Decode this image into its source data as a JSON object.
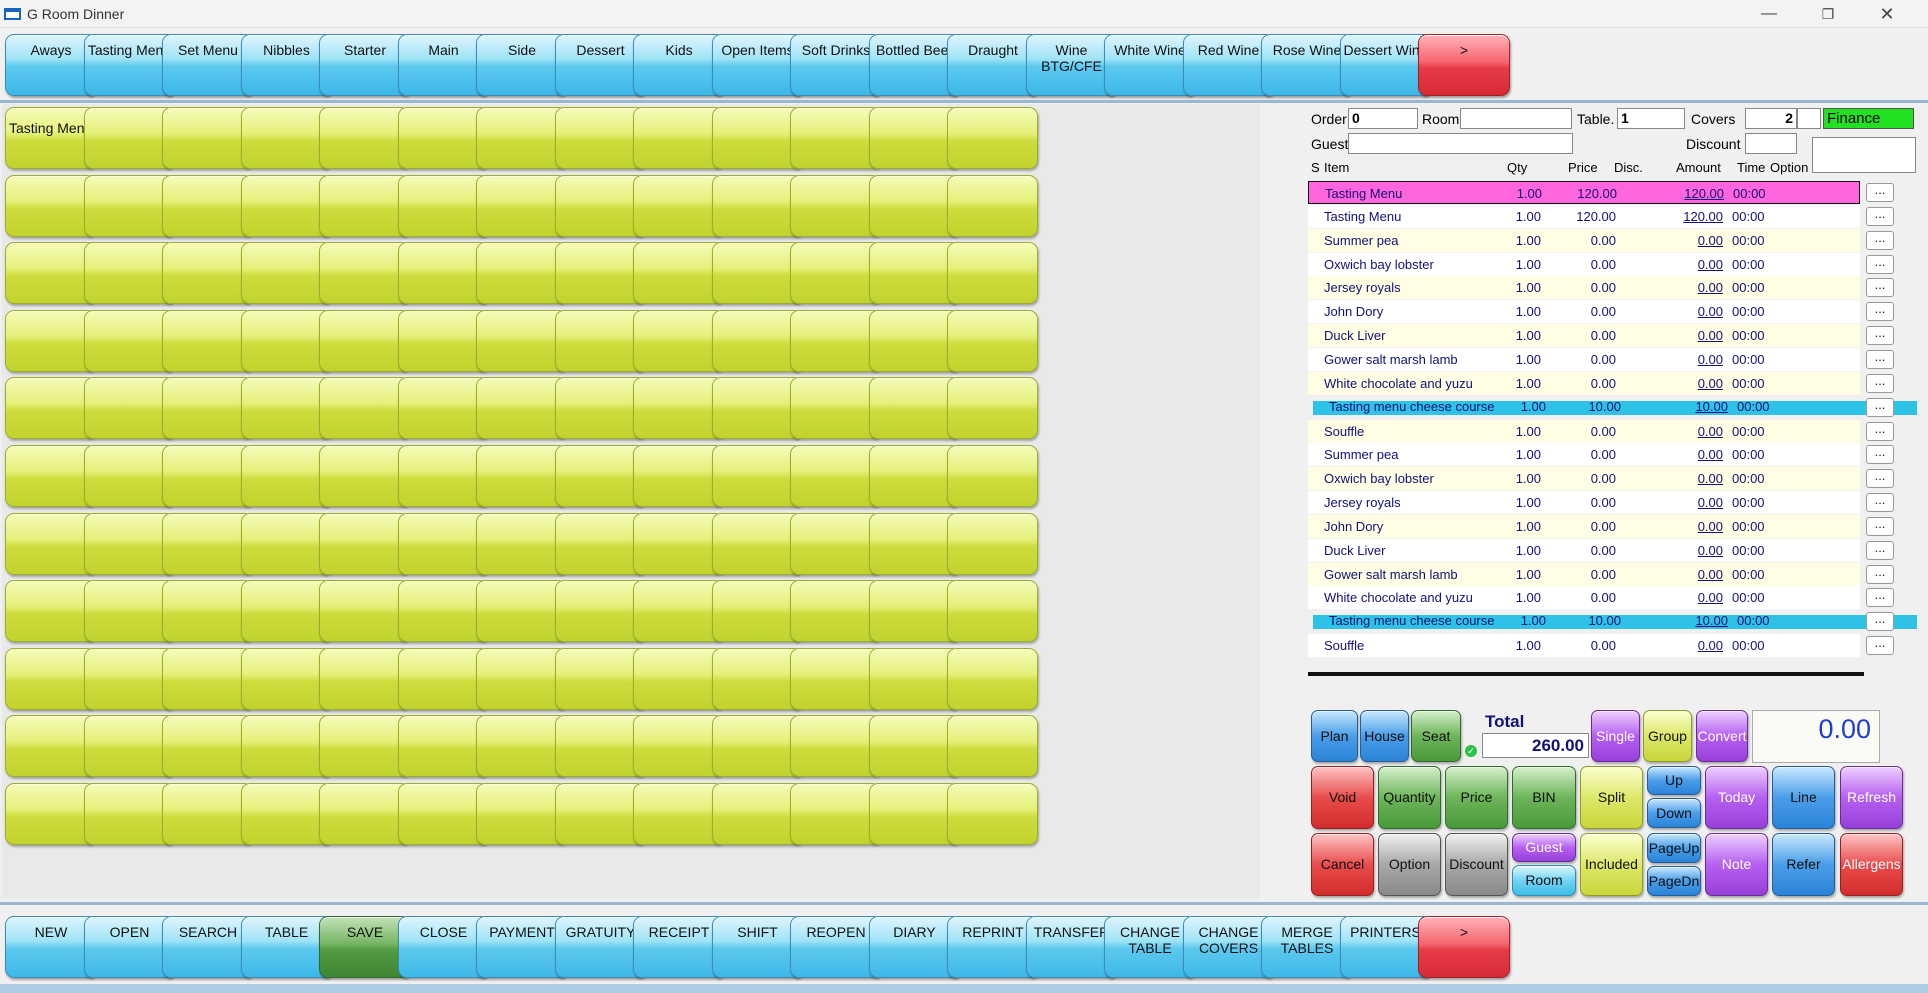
{
  "window": {
    "title": "G Room Dinner",
    "minimize": "—",
    "maximize": "❐",
    "close": "✕"
  },
  "top_categories": [
    "Aways",
    "Tasting Menu",
    "Set Menu",
    "Nibbles",
    "Starter",
    "Main",
    "Side",
    "Dessert",
    "Kids",
    "Open Items",
    "Soft Drinks",
    "Bottled Beer",
    "Draught",
    "Wine BTG/CFE",
    "White Wine",
    "Red Wine",
    "Rose Wine",
    "Dessert Wine"
  ],
  "top_more": ">",
  "grid": {
    "first_item": "Tasting Menu",
    "columns": 13,
    "rows": 11
  },
  "order_header": {
    "order_label": "Order",
    "order_value": "0",
    "room_label": "Room",
    "room_value": "",
    "table_label": "Table.",
    "table_value": "1",
    "covers_label": "Covers",
    "covers_value": "2",
    "finance": "Finance",
    "guest_label": "Guest",
    "guest_value": "",
    "discount_label": "Discount",
    "discount_value": ""
  },
  "columns": {
    "s": "S",
    "item": "Item",
    "qty": "Qty",
    "price": "Price",
    "disc": "Disc.",
    "amount": "Amount",
    "time": "Time",
    "option": "Option"
  },
  "order_lines": [
    {
      "item": "Tasting Menu",
      "qty": "1.00",
      "price": "120.00",
      "amount": "120.00",
      "time": "00:00",
      "style": "pink"
    },
    {
      "item": "Tasting Menu",
      "qty": "1.00",
      "price": "120.00",
      "amount": "120.00",
      "time": "00:00",
      "style": "white"
    },
    {
      "item": "Summer pea",
      "qty": "1.00",
      "price": "0.00",
      "amount": "0.00",
      "time": "00:00",
      "style": "cream"
    },
    {
      "item": "Oxwich bay lobster",
      "qty": "1.00",
      "price": "0.00",
      "amount": "0.00",
      "time": "00:00",
      "style": "white"
    },
    {
      "item": "Jersey royals",
      "qty": "1.00",
      "price": "0.00",
      "amount": "0.00",
      "time": "00:00",
      "style": "cream"
    },
    {
      "item": "John Dory",
      "qty": "1.00",
      "price": "0.00",
      "amount": "0.00",
      "time": "00:00",
      "style": "white"
    },
    {
      "item": "Duck Liver",
      "qty": "1.00",
      "price": "0.00",
      "amount": "0.00",
      "time": "00:00",
      "style": "cream"
    },
    {
      "item": "Gower salt marsh lamb",
      "qty": "1.00",
      "price": "0.00",
      "amount": "0.00",
      "time": "00:00",
      "style": "white"
    },
    {
      "item": "White chocolate and yuzu",
      "qty": "1.00",
      "price": "0.00",
      "amount": "0.00",
      "time": "00:00",
      "style": "cream"
    },
    {
      "item": "Tasting menu cheese course",
      "qty": "1.00",
      "price": "10.00",
      "amount": "10.00",
      "time": "00:00",
      "style": "cyan"
    },
    {
      "item": "Souffle",
      "qty": "1.00",
      "price": "0.00",
      "amount": "0.00",
      "time": "00:00",
      "style": "cream"
    },
    {
      "item": "Summer pea",
      "qty": "1.00",
      "price": "0.00",
      "amount": "0.00",
      "time": "00:00",
      "style": "white"
    },
    {
      "item": "Oxwich bay lobster",
      "qty": "1.00",
      "price": "0.00",
      "amount": "0.00",
      "time": "00:00",
      "style": "cream"
    },
    {
      "item": "Jersey royals",
      "qty": "1.00",
      "price": "0.00",
      "amount": "0.00",
      "time": "00:00",
      "style": "white"
    },
    {
      "item": "John Dory",
      "qty": "1.00",
      "price": "0.00",
      "amount": "0.00",
      "time": "00:00",
      "style": "cream"
    },
    {
      "item": "Duck Liver",
      "qty": "1.00",
      "price": "0.00",
      "amount": "0.00",
      "time": "00:00",
      "style": "white"
    },
    {
      "item": "Gower salt marsh lamb",
      "qty": "1.00",
      "price": "0.00",
      "amount": "0.00",
      "time": "00:00",
      "style": "cream"
    },
    {
      "item": "White chocolate and yuzu",
      "qty": "1.00",
      "price": "0.00",
      "amount": "0.00",
      "time": "00:00",
      "style": "white"
    },
    {
      "item": "Tasting menu cheese course",
      "qty": "1.00",
      "price": "10.00",
      "amount": "10.00",
      "time": "00:00",
      "style": "cyan"
    },
    {
      "item": "Souffle",
      "qty": "1.00",
      "price": "0.00",
      "amount": "0.00",
      "time": "00:00",
      "style": "white"
    }
  ],
  "option_button": "...",
  "totals": {
    "total_label": "Total",
    "total_value": "260.00",
    "amount_display": "0.00"
  },
  "controls": {
    "plan": "Plan",
    "house": "House",
    "seat": "Seat",
    "single": "Single",
    "group": "Group",
    "convert": "Convert",
    "void": "Void",
    "quantity": "Quantity",
    "price": "Price",
    "bin": "BIN",
    "split": "Split",
    "up": "Up",
    "down": "Down",
    "today": "Today",
    "line": "Line",
    "refresh": "Refresh",
    "cancel": "Cancel",
    "option": "Option",
    "discount": "Discount",
    "guest": "Guest",
    "room": "Room",
    "included": "Included",
    "pageup": "PageUp",
    "pagedn": "PageDn",
    "note": "Note",
    "refer": "Refer",
    "allergens": "Allergens"
  },
  "bottom_actions": [
    "NEW",
    "OPEN",
    "SEARCH",
    "TABLE",
    "SAVE",
    "CLOSE",
    "PAYMENT",
    "GRATUITY",
    "RECEIPT",
    "SHIFT",
    "REOPEN",
    "DIARY",
    "REPRINT",
    "TRANSFER",
    "CHANGE TABLE",
    "CHANGE COVERS",
    "MERGE TABLES",
    "PRINTERS"
  ],
  "bottom_more": ">"
}
